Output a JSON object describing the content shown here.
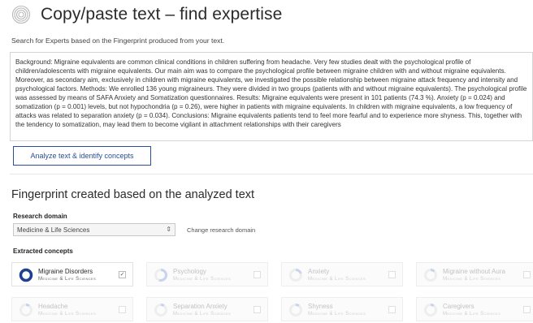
{
  "header": {
    "title": "Copy/paste text – find expertise",
    "subtitle": "Search for Experts based on the Fingerprint produced from your text."
  },
  "input": {
    "text": "Background: Migraine equivalents are common clinical conditions in children suffering from headache. Very few studies dealt with the psychological profile of children/adolescents with migraine equivalents. Our main aim was to compare the psychological profile between migraine children with and without migraine equivalents. Moreover, as secondary aim, exclusively in children with migraine equivalents, we investigated the possible relationship between migraine attack frequency and intensity and psychological factors. Methods: We enrolled 136 young migraineurs. They were divided in two groups (patients with and without migraine equivalents). The psychological profile was assessed by means of SAFA Anxiety and Somatization questionnaires. Results: Migraine equivalents were present in 101 patients (74.3 %). Anxiety (p = 0.024) and somatization (p = 0.001) levels, but not hypochondria (p = 0.26), were higher in patients with migraine equivalents. In children with migraine equivalents, a low frequency of attacks was related to separation anxiety (p = 0.034). Conclusions: Migraine equivalents patients tend to feel more fearful and to experience more shyness. This, together with the tendency to somatization, may lead them to become vigilant in attachment relationships with their caregivers"
  },
  "analyze_button": "Analyze text & identify concepts",
  "fingerprint": {
    "heading": "Fingerprint created based on the analyzed text",
    "research_domain_label": "Research domain",
    "research_domain_value": "Medicine & Life Sciences",
    "change_link": "Change research domain",
    "extracted_label": "Extracted concepts",
    "concepts": [
      {
        "name": "Migraine Disorders",
        "domain": "Medicine & Life Sciences",
        "checked": true,
        "fraction": 1.0
      },
      {
        "name": "Psychology",
        "domain": "Medicine & Life Sciences",
        "checked": false,
        "fraction": 0.55
      },
      {
        "name": "Anxiety",
        "domain": "Medicine & Life Sciences",
        "checked": false,
        "fraction": 0.2
      },
      {
        "name": "Migraine without Aura",
        "domain": "Medicine & Life Sciences",
        "checked": false,
        "fraction": 0.12
      },
      {
        "name": "Headache",
        "domain": "Medicine & Life Sciences",
        "checked": false,
        "fraction": 0.1
      },
      {
        "name": "Separation Anxiety",
        "domain": "Medicine & Life Sciences",
        "checked": false,
        "fraction": 0.1
      },
      {
        "name": "Shyness",
        "domain": "Medicine & Life Sciences",
        "checked": false,
        "fraction": 0.1
      },
      {
        "name": "Caregivers",
        "domain": "Medicine & Life Sciences",
        "checked": false,
        "fraction": 0.1
      }
    ]
  },
  "colors": {
    "accent": "#2a4d9a",
    "ring_active": "#1f3f91",
    "ring_inactive": "#c9d3ee",
    "ring_track": "#eeeeee"
  }
}
